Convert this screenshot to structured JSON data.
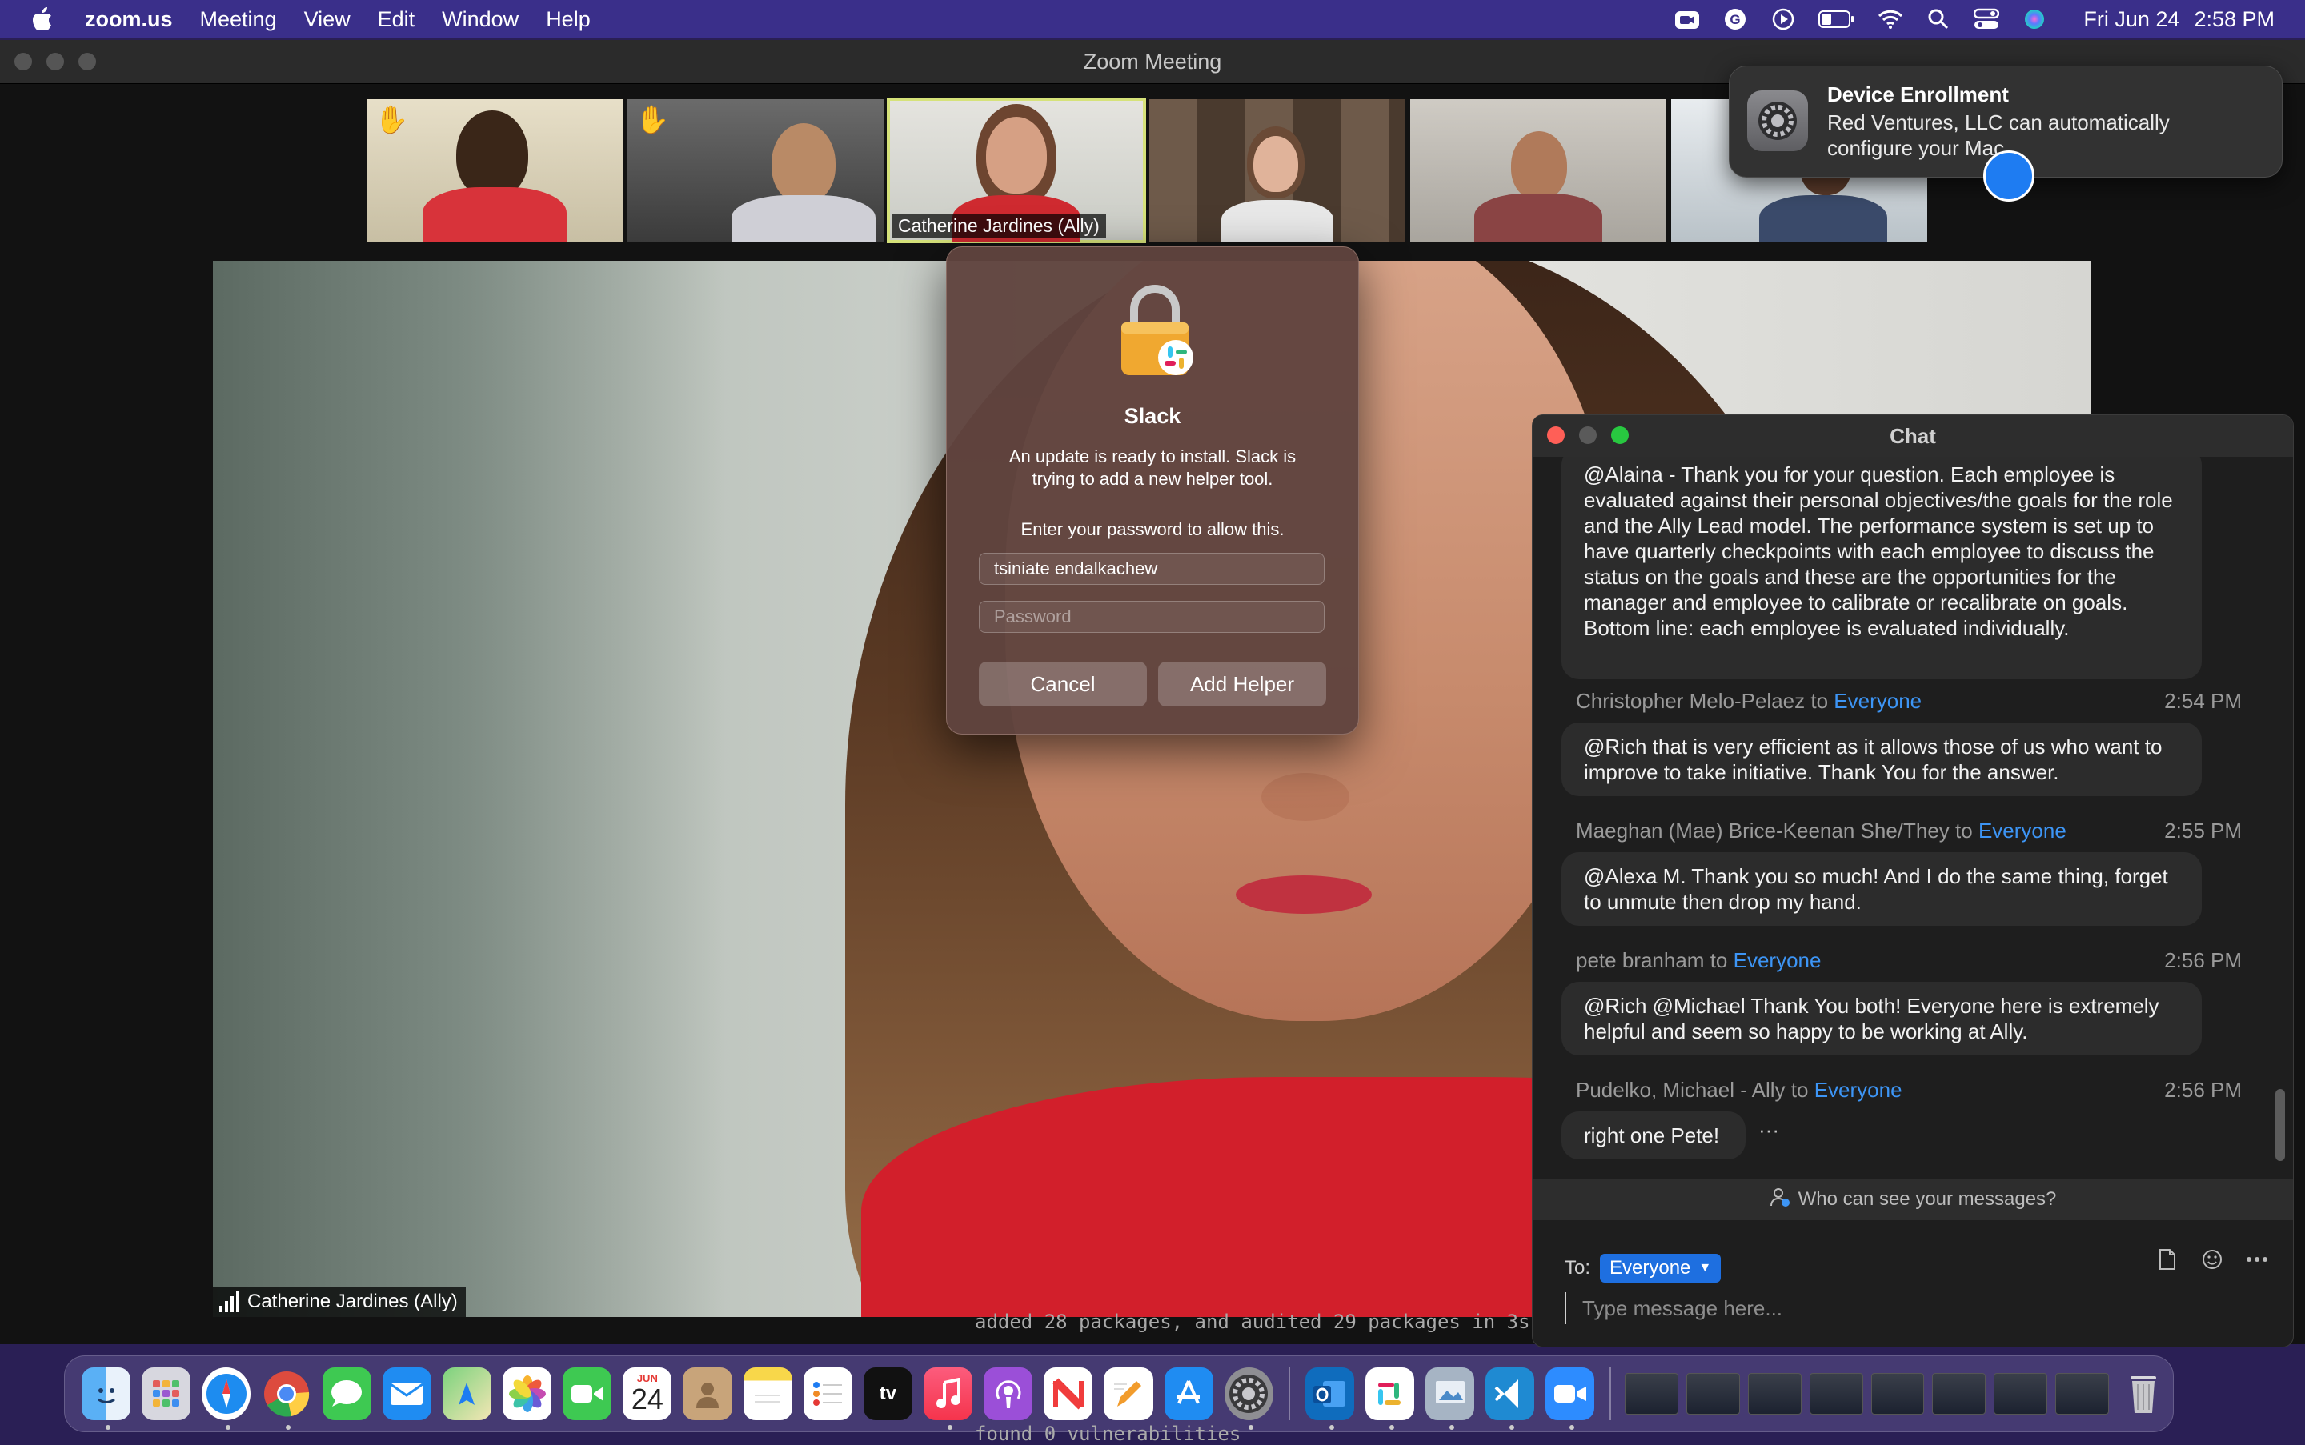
{
  "menubar": {
    "app": "zoom.us",
    "items": [
      "Meeting",
      "View",
      "Edit",
      "Window",
      "Help"
    ],
    "date": "Fri Jun 24",
    "time": "2:58 PM"
  },
  "zoom": {
    "window_title": "Zoom Meeting",
    "active_thumb_name": "Catherine Jardines (Ally)",
    "speaker_name": "Catherine Jardines (Ally)",
    "terminal_line_1": "added 28 packages, and audited 29 packages in 3s",
    "terminal_line_2": "found 0 vulnerabilities"
  },
  "notification": {
    "title": "Device Enrollment",
    "body": "Red Ventures, LLC can automatically configure your Mac."
  },
  "slack_dialog": {
    "title": "Slack",
    "message": "An update is ready to install. Slack is trying to add a new helper tool.",
    "prompt": "Enter your password to allow this.",
    "username": "tsiniate endalkachew",
    "password_placeholder": "Password",
    "cancel": "Cancel",
    "confirm": "Add Helper"
  },
  "chat": {
    "title": "Chat",
    "messages": [
      {
        "text": "@Alaina  - Thank you for your question.  Each employee is evaluated against their personal objectives/the goals for the role and the Ally Lead model.  The performance system is set up to have quarterly checkpoints with each employee to discuss the status on the goals and these are the opportunities for the manager and employee to calibrate or recalibrate on goals.  Bottom line:  each employee is evaluated individually."
      },
      {
        "sender": "Christopher Melo-Pelaez",
        "to": "to",
        "recipient": "Everyone",
        "time": "2:54 PM",
        "text": "@Rich that is very efficient as it allows those of us who want to improve to take initiative. Thank You for the answer."
      },
      {
        "sender": "Maeghan (Mae) Brice-Keenan She/They",
        "to": "to",
        "recipient": "Everyone",
        "time": "2:55 PM",
        "text": "@Alexa M. Thank you so much! And I do the same thing, forget to unmute then drop my hand."
      },
      {
        "sender": "pete branham",
        "to": "to",
        "recipient": "Everyone",
        "time": "2:56 PM",
        "text": "@Rich @Michael Thank You both! Everyone here is extremely helpful and seem so happy to be working at Ally."
      },
      {
        "sender": "Pudelko, Michael - Ally",
        "to": "to",
        "recipient": "Everyone",
        "time": "2:56 PM",
        "text": "right one Pete!"
      }
    ],
    "more": "···",
    "who_can_see": "Who can see your messages?",
    "to_label": "To:",
    "to_value": "Everyone",
    "compose_placeholder": "Type message here..."
  },
  "dock": {
    "calendar_month": "JUN",
    "calendar_day": "24",
    "tv_label": "tv"
  }
}
